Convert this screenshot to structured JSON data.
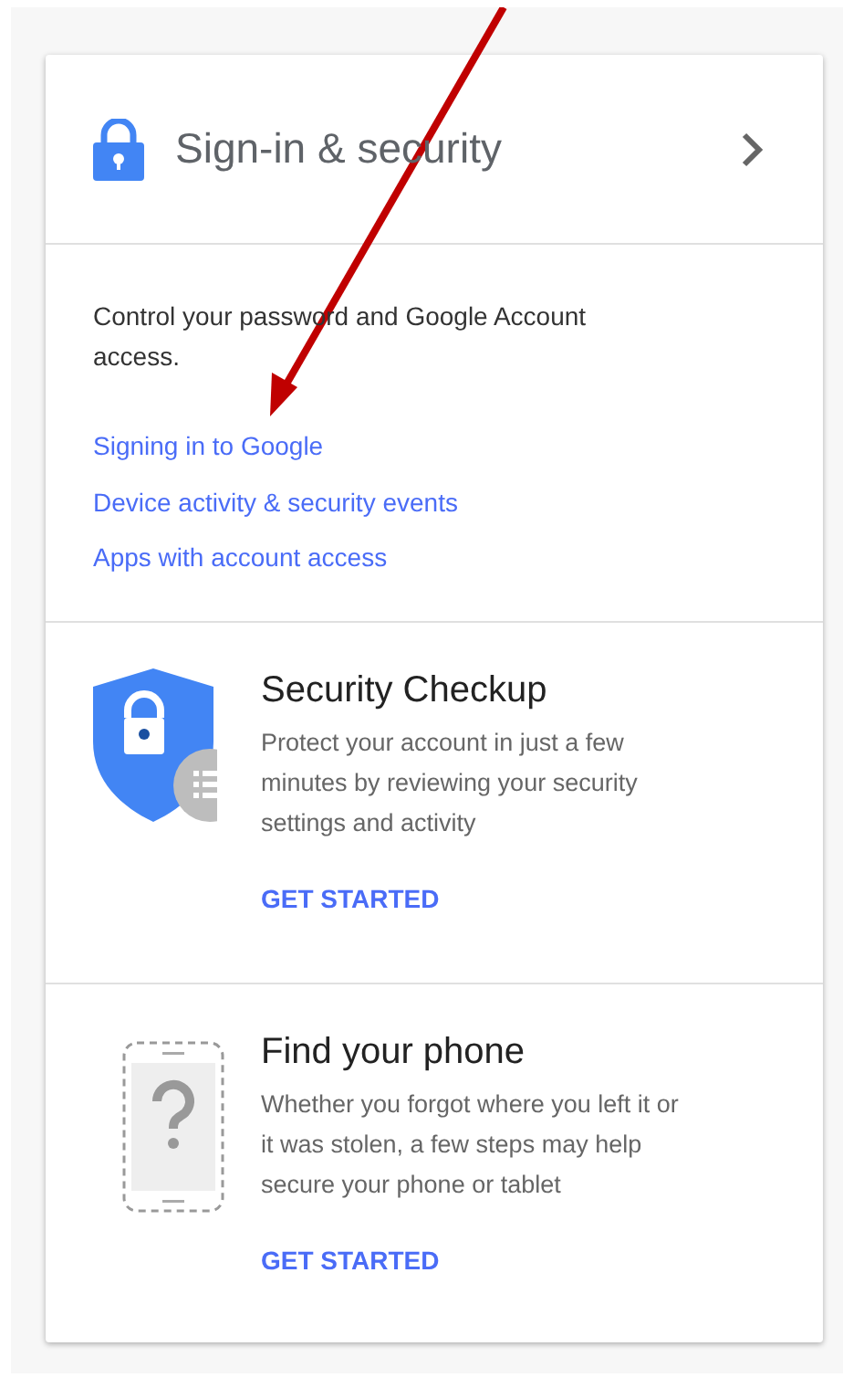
{
  "header": {
    "title": "Sign-in & security"
  },
  "intro": {
    "description": "Control your password and Google Account access.",
    "links": [
      "Signing in to Google",
      "Device activity & security events",
      "Apps with account access"
    ]
  },
  "features": [
    {
      "kind": "shield",
      "title": "Security Checkup",
      "description": "Protect your account in just a few minutes by reviewing your security settings and activity",
      "action": "GET STARTED"
    },
    {
      "kind": "phone",
      "title": "Find your phone",
      "description": "Whether you forgot where you left it or it was stolen, a few steps may help secure your phone or tablet",
      "action": "GET STARTED"
    }
  ]
}
